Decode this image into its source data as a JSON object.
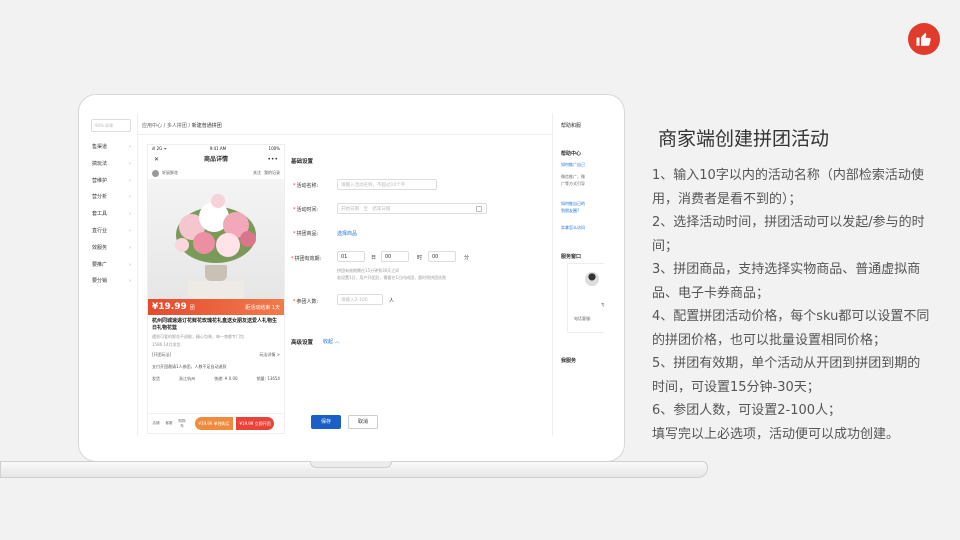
{
  "heading": "商家端创建拼团活动",
  "description": [
    "1、输入10字以内的活动名称（内部检索活动使用，消费者是看不到的）；",
    "2、选择活动时间，拼团活动可以发起/参与的时间；",
    "3、拼团商品，支持选择实物商品、普通虚拟商品、电子卡券商品；",
    "4、配置拼团活动价格，每个sku都可以设置不同的拼团价格，也可以批量设置相同价格；",
    "5、拼团有效期，单个活动从开团到拼团到期的时间，可设置15分钟-30天；",
    "6、参团人数，可设置2-100人；",
    "填写完以上必选项，活动便可以成功创建。"
  ],
  "like_icon": "thumbs-up-icon",
  "accent_color": "#e03b2b",
  "screen": {
    "search_placeholder": "90%.如果",
    "sidebar": [
      "售渠道",
      "搞玩法",
      "营维护",
      "营分析",
      "套工具",
      "直行业",
      "效服务",
      "要推广",
      "要分销"
    ],
    "breadcrumb": {
      "a": "应用中心",
      "sep": "/",
      "b": "多人拼团",
      "c": "新建普通拼团"
    },
    "phone": {
      "status_left": "ıll 2G ᯤ",
      "status_mid": "9:41 AM",
      "status_right": "100%",
      "nav_title": "商品详情",
      "nav_close": "✕",
      "nav_more": "•••",
      "shop_name": "轩辰鲜花",
      "follow": "关注",
      "history": "我的记录",
      "price": "¥19.99",
      "price_tag": "团",
      "price_right": "距活动结束 1天",
      "title": "杭州同城速递订花鲜花玫瑰花礼盒送女朋友送爱人礼物生日礼物花篮",
      "sub": "遇到可爱的鲜花不退能，精心包装，每一束都专门包",
      "sub2": "1586 14月发货",
      "group_label": "[开团玩法]",
      "group_more": "玩法详情 >",
      "group_desc": "支付开团邀请1人参团，人数不足自动退款",
      "ship": "发货",
      "ship_loc": "浙江杭州",
      "ship_fee": "快递: ¥ 0.00",
      "sales": "销量: 13654",
      "icons": [
        "店铺",
        "客服",
        "购物车"
      ],
      "btn_single": "单独购买",
      "btn_single_price": "¥39.99",
      "btn_group": "立即开团",
      "btn_group_price": "¥19.99"
    },
    "form": {
      "section_basic": "基础设置",
      "name_label": "活动名称:",
      "name_placeholder": "请输入活动名称，不超过10个字",
      "time_label": "活动时间:",
      "time_start": "开始日期",
      "time_sep": "至",
      "time_end": "结束日期",
      "goods_label": "拼团商品:",
      "goods_link": "选择商品",
      "valid_label": "拼团有效期:",
      "valid_d": "01",
      "valid_d_unit": "日",
      "valid_h": "00",
      "valid_h_unit": "时",
      "valid_m": "00",
      "valid_m_unit": "分",
      "valid_help1": "拼团有效期需在15分钟到30天之间",
      "valid_help2": "若设置1日，用户开团后，需要在1日内成团，超时则拼团失败",
      "people_label": "参团人数:",
      "people_placeholder": "请输入2-100",
      "people_unit": "人",
      "section_adv": "高级设置",
      "collapse": "收起 ︿",
      "save": "保存",
      "cancel": "取消"
    },
    "right_panel": {
      "help": "帮助和服",
      "help_center": "帮助中心",
      "q1a": "如何推广自己",
      "q1b": "微信推广，微",
      "q1c": "广等方式引导",
      "q2a": "如何推自己的",
      "q2b": "到朋友圈?",
      "q3": "实拿怎么访问",
      "service": "服务窗口",
      "service_tag": "专",
      "service_phone": "电话客服:",
      "my_service": "我服务"
    }
  }
}
